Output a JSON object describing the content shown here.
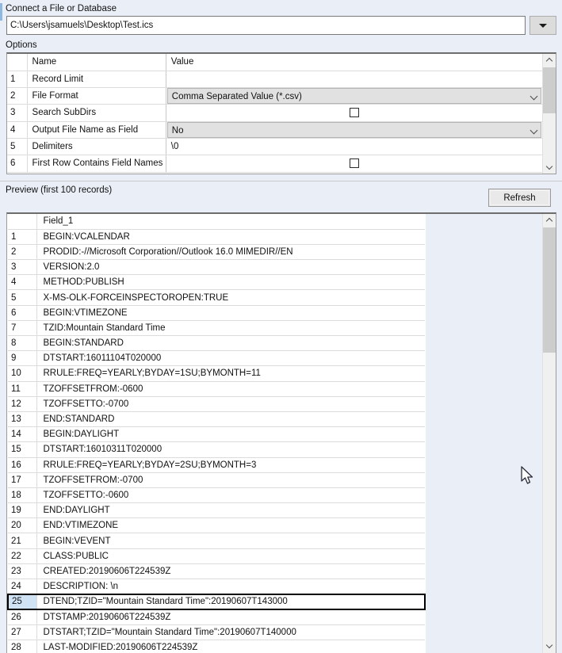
{
  "connect": {
    "label": "Connect a File or Database",
    "path_value": "C:\\Users\\jsamuels\\Desktop\\Test.ics",
    "path_placeholder": "",
    "dropdown_icon": "caret-down-icon"
  },
  "options": {
    "label": "Options",
    "columns": [
      "",
      "Name",
      "Value"
    ],
    "rows": [
      {
        "num": "1",
        "name": "Record Limit",
        "value": "",
        "type": "text"
      },
      {
        "num": "2",
        "name": "File Format",
        "value": "Comma Separated Value (*.csv)",
        "type": "combo"
      },
      {
        "num": "3",
        "name": "Search SubDirs",
        "value": "",
        "type": "checkbox",
        "checked": false
      },
      {
        "num": "4",
        "name": "Output File Name as Field",
        "value": "No",
        "type": "combo"
      },
      {
        "num": "5",
        "name": "Delimiters",
        "value": "\\0",
        "type": "text"
      },
      {
        "num": "6",
        "name": "First Row Contains Field Names",
        "value": "",
        "type": "checkbox",
        "checked": false
      }
    ],
    "scrollbar": {
      "up_icon": "chevron-up-icon",
      "down_icon": "chevron-down-icon"
    }
  },
  "preview": {
    "label": "Preview (first 100 records)",
    "refresh_label": "Refresh",
    "column_header": "Field_1",
    "selected_row": "25",
    "rows": [
      {
        "num": "1",
        "value": "BEGIN:VCALENDAR"
      },
      {
        "num": "2",
        "value": "PRODID:-//Microsoft Corporation//Outlook 16.0 MIMEDIR//EN"
      },
      {
        "num": "3",
        "value": "VERSION:2.0"
      },
      {
        "num": "4",
        "value": "METHOD:PUBLISH"
      },
      {
        "num": "5",
        "value": "X-MS-OLK-FORCEINSPECTOROPEN:TRUE"
      },
      {
        "num": "6",
        "value": "BEGIN:VTIMEZONE"
      },
      {
        "num": "7",
        "value": "TZID:Mountain Standard Time"
      },
      {
        "num": "8",
        "value": "BEGIN:STANDARD"
      },
      {
        "num": "9",
        "value": "DTSTART:16011104T020000"
      },
      {
        "num": "10",
        "value": "RRULE:FREQ=YEARLY;BYDAY=1SU;BYMONTH=11"
      },
      {
        "num": "11",
        "value": "TZOFFSETFROM:-0600"
      },
      {
        "num": "12",
        "value": "TZOFFSETTO:-0700"
      },
      {
        "num": "13",
        "value": "END:STANDARD"
      },
      {
        "num": "14",
        "value": "BEGIN:DAYLIGHT"
      },
      {
        "num": "15",
        "value": "DTSTART:16010311T020000"
      },
      {
        "num": "16",
        "value": "RRULE:FREQ=YEARLY;BYDAY=2SU;BYMONTH=3"
      },
      {
        "num": "17",
        "value": "TZOFFSETFROM:-0700"
      },
      {
        "num": "18",
        "value": "TZOFFSETTO:-0600"
      },
      {
        "num": "19",
        "value": "END:DAYLIGHT"
      },
      {
        "num": "20",
        "value": "END:VTIMEZONE"
      },
      {
        "num": "21",
        "value": "BEGIN:VEVENT"
      },
      {
        "num": "22",
        "value": "CLASS:PUBLIC"
      },
      {
        "num": "23",
        "value": "CREATED:20190606T224539Z"
      },
      {
        "num": "24",
        "value": "DESCRIPTION: \\n"
      },
      {
        "num": "25",
        "value": "DTEND;TZID=\"Mountain Standard Time\":20190607T143000"
      },
      {
        "num": "26",
        "value": "DTSTAMP:20190606T224539Z"
      },
      {
        "num": "27",
        "value": "DTSTART;TZID=\"Mountain Standard Time\":20190607T140000"
      },
      {
        "num": "28",
        "value": "LAST-MODIFIED:20190606T224539Z"
      }
    ],
    "scrollbar": {
      "up_icon": "chevron-up-icon",
      "down_icon": "chevron-down-icon"
    }
  },
  "colors": {
    "window_background": "#eaeff7",
    "grid_background": "#ffffff",
    "selection_row_number": "#cfe3f5",
    "combo_background": "#e1e1e1",
    "scrollbar_thumb": "#cdcdcd",
    "accent": "#8fb8e0"
  }
}
